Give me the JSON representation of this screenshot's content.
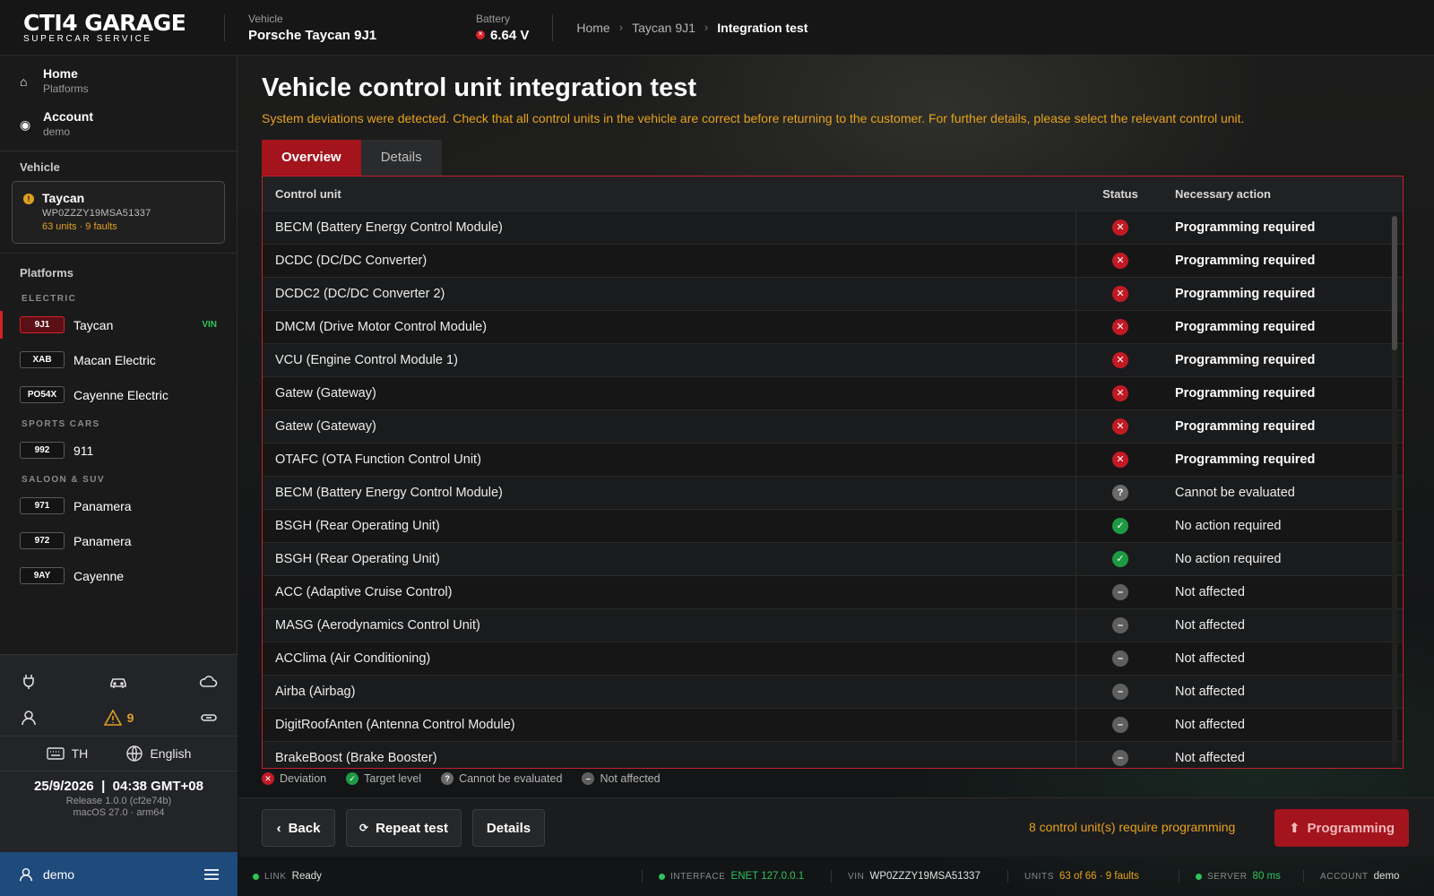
{
  "header": {
    "logo_main": "CTI4 GARAGE",
    "logo_sub": "SUPERCAR SERVICE",
    "vehicle_label": "Vehicle",
    "vehicle_value": "Porsche Taycan 9J1",
    "battery_label": "Battery",
    "battery_value": "6.64 V",
    "breadcrumb": [
      "Home",
      "Taycan 9J1",
      "Integration test"
    ]
  },
  "sidebar": {
    "nav": [
      {
        "title": "Home",
        "sub": "Platforms",
        "icon": "home-icon"
      },
      {
        "title": "Account",
        "sub": "demo",
        "icon": "account-icon"
      }
    ],
    "vehicle_section": "Vehicle",
    "vehicle_card": {
      "name": "Taycan",
      "vin": "WP0ZZZY19MSA51337",
      "faults": "63 units · 9 faults"
    },
    "platforms_section": "Platforms",
    "groups": [
      {
        "name": "ELECTRIC",
        "items": [
          {
            "badge": "9J1",
            "name": "Taycan",
            "tag": "VIN",
            "active": true
          },
          {
            "badge": "XAB",
            "name": "Macan Electric",
            "tag": ""
          },
          {
            "badge": "PO54X",
            "name": "Cayenne Electric",
            "tag": ""
          }
        ]
      },
      {
        "name": "SPORTS CARS",
        "items": [
          {
            "badge": "992",
            "name": "911",
            "tag": ""
          }
        ]
      },
      {
        "name": "SALOON & SUV",
        "items": [
          {
            "badge": "971",
            "name": "Panamera",
            "tag": ""
          },
          {
            "badge": "972",
            "name": "Panamera",
            "tag": ""
          },
          {
            "badge": "9AY",
            "name": "Cayenne",
            "tag": ""
          }
        ]
      }
    ],
    "warning_count": "9",
    "keyboard": "TH",
    "language": "English",
    "date": "25/9/2026",
    "time": "04:38 GMT+08",
    "release": "Release 1.0.0 (cf2e74b)",
    "os": "macOS 27.0 · arm64",
    "user": "demo"
  },
  "main": {
    "title": "Vehicle control unit integration test",
    "subtitle": "System deviations were detected. Check that all control units in the vehicle are correct before returning to the customer. For further details, please select the relevant control unit.",
    "tabs": [
      "Overview",
      "Details"
    ],
    "columns": [
      "Control unit",
      "Status",
      "Necessary action"
    ],
    "rows": [
      {
        "unit": "BECM (Battery Energy Control Module)",
        "status": "x",
        "action": "Programming required"
      },
      {
        "unit": "DCDC (DC/DC Converter)",
        "status": "x",
        "action": "Programming required"
      },
      {
        "unit": "DCDC2 (DC/DC Converter 2)",
        "status": "x",
        "action": "Programming required"
      },
      {
        "unit": "DMCM (Drive Motor Control Module)",
        "status": "x",
        "action": "Programming required"
      },
      {
        "unit": "VCU (Engine Control Module 1)",
        "status": "x",
        "action": "Programming required"
      },
      {
        "unit": "Gatew (Gateway)",
        "status": "x",
        "action": "Programming required"
      },
      {
        "unit": "Gatew (Gateway)",
        "status": "x",
        "action": "Programming required"
      },
      {
        "unit": "OTAFC (OTA Function Control Unit)",
        "status": "x",
        "action": "Programming required"
      },
      {
        "unit": "BECM (Battery Energy Control Module)",
        "status": "q",
        "action": "Cannot be evaluated"
      },
      {
        "unit": "BSGH (Rear Operating Unit)",
        "status": "ok",
        "action": "No action required"
      },
      {
        "unit": "BSGH (Rear Operating Unit)",
        "status": "ok",
        "action": "No action required"
      },
      {
        "unit": "ACC (Adaptive Cruise Control)",
        "status": "na",
        "action": "Not affected"
      },
      {
        "unit": "MASG (Aerodynamics Control Unit)",
        "status": "na",
        "action": "Not affected"
      },
      {
        "unit": "ACClima (Air Conditioning)",
        "status": "na",
        "action": "Not affected"
      },
      {
        "unit": "Airba (Airbag)",
        "status": "na",
        "action": "Not affected"
      },
      {
        "unit": "DigitRoofAnten (Antenna Control Module)",
        "status": "na",
        "action": "Not affected"
      },
      {
        "unit": "BrakeBoost (Brake Booster)",
        "status": "na",
        "action": "Not affected"
      }
    ],
    "legend": [
      "Deviation",
      "Target level",
      "Cannot be evaluated",
      "Not affected"
    ]
  },
  "actions": {
    "back": "Back",
    "repeat": "Repeat test",
    "details": "Details",
    "note": "8 control unit(s) require programming",
    "programming": "Programming"
  },
  "statusbar": {
    "link_label": "LINK",
    "link_value": "Ready",
    "interface_label": "INTERFACE",
    "interface_value": "ENET 127.0.0.1",
    "vin_label": "VIN",
    "vin_value": "WP0ZZZY19MSA51337",
    "units_label": "UNITS",
    "units_value": "63 of 66 · 9 faults",
    "server_label": "SERVER",
    "server_value": "80 ms",
    "account_label": "ACCOUNT",
    "account_value": "demo"
  },
  "colors": {
    "accent": "#a3141d",
    "warning": "#e6a21c",
    "ok": "#1f9a44",
    "user_bar": "#1e4a7c"
  }
}
